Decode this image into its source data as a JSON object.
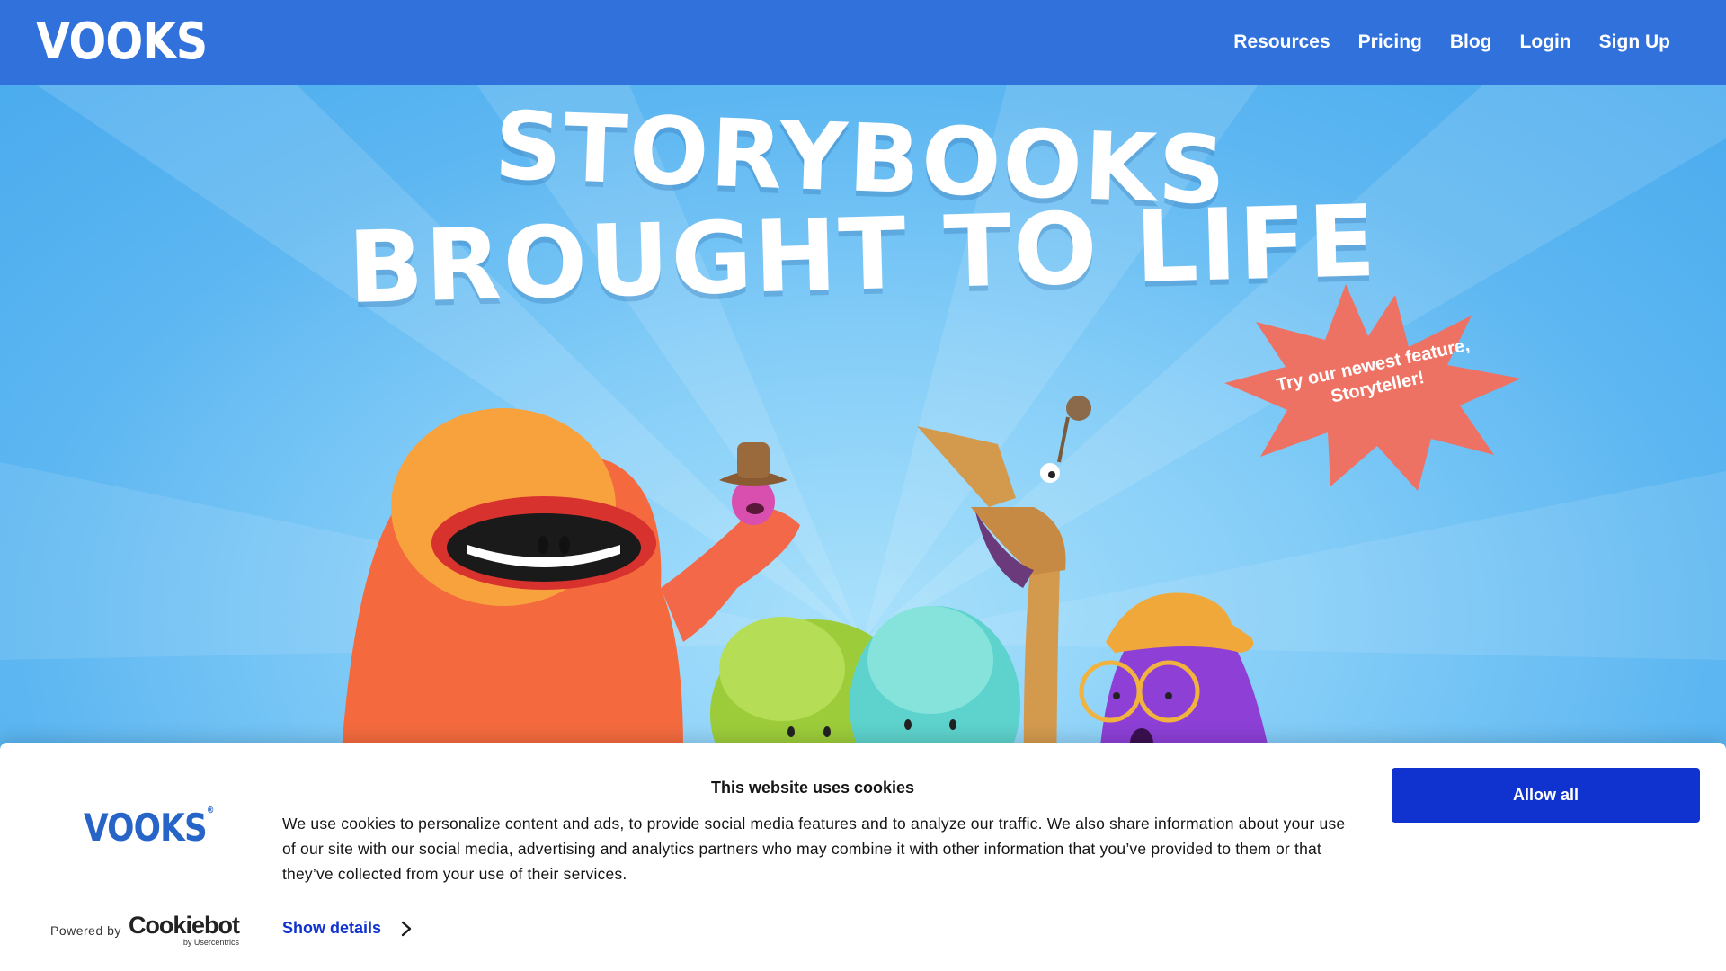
{
  "nav": {
    "logo": "VOOKS",
    "links": [
      "Resources",
      "Pricing",
      "Blog",
      "Login",
      "Sign Up"
    ]
  },
  "hero": {
    "headline_line1": "STORYBOOKS",
    "headline_line2": "BROUGHT TO LIFE",
    "burst_text": "Try our newest feature, Storyteller!"
  },
  "cookie_banner": {
    "logo": "VOOKS",
    "title": "This website uses cookies",
    "body": "We use cookies to personalize content and ads, to provide social media features and to analyze our traffic. We also share information about your use of our site with our social media, advertising and analytics partners who may combine it with other information that you’ve provided to them or that they’ve collected from your use of their services.",
    "show_details": "Show details",
    "allow_all": "Allow all",
    "powered_by": "Powered by",
    "cookiebot": "Cookiebot",
    "cookiebot_sub": "by Usercentrics"
  },
  "colors": {
    "nav_bg": "#3171dc",
    "burst": "#ee7264",
    "allow_button": "#1032cf",
    "link": "#1032cf"
  }
}
